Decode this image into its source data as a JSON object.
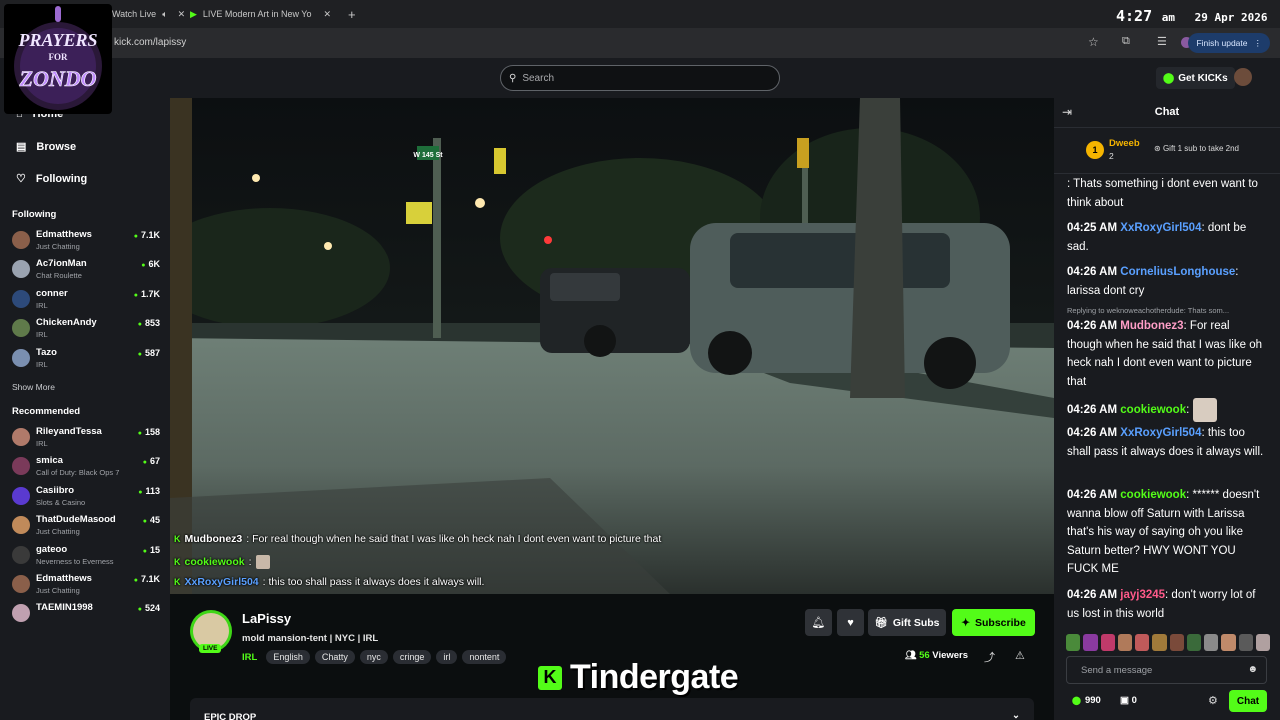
{
  "browser": {
    "tabs": [
      {
        "label": "Watch Live"
      },
      {
        "label": "LIVE Modern Art in New Yo"
      }
    ],
    "url": "kick.com/lapissy",
    "finish_update": "Finish update"
  },
  "clock": {
    "time": "4:27",
    "ampm": "am",
    "date": "29 Apr 2026"
  },
  "logo": {
    "line1": "PRAYERS",
    "line2": "FOR",
    "line3": "ZONDO"
  },
  "header": {
    "search_placeholder": "Search",
    "get_kicks": "Get KICKs"
  },
  "sidebar": {
    "nav": [
      {
        "label": "Home"
      },
      {
        "label": "Browse"
      },
      {
        "label": "Following"
      }
    ],
    "following_heading": "Following",
    "following": [
      {
        "name": "Edmatthews",
        "category": "Just Chatting",
        "viewers": "7.1K",
        "color": "#8a5f4a"
      },
      {
        "name": "Ac7ionMan",
        "category": "Chat Roulette",
        "viewers": "6K",
        "color": "#9aa3b0"
      },
      {
        "name": "conner",
        "category": "IRL",
        "viewers": "1.7K",
        "color": "#2d4a7a"
      },
      {
        "name": "ChickenAndy",
        "category": "IRL",
        "viewers": "853",
        "color": "#5f7a4a"
      },
      {
        "name": "Tazo",
        "category": "IRL",
        "viewers": "587",
        "color": "#7a8fb0"
      }
    ],
    "show_more": "Show More",
    "recommended_heading": "Recommended",
    "recommended": [
      {
        "name": "RileyandTessa",
        "category": "IRL",
        "viewers": "158",
        "color": "#b07a6a"
      },
      {
        "name": "smica",
        "category": "Call of Duty: Black Ops 7",
        "viewers": "67",
        "color": "#7a3a5a"
      },
      {
        "name": "Casiibro",
        "category": "Slots & Casino",
        "viewers": "113",
        "color": "#5a3ad0"
      },
      {
        "name": "ThatDudeMasood",
        "category": "Just Chatting",
        "viewers": "45",
        "color": "#c08a5a"
      },
      {
        "name": "gateoo",
        "category": "Neverness to Everness",
        "viewers": "15",
        "color": "#3a3a3a"
      },
      {
        "name": "Edmatthews",
        "category": "Just Chatting",
        "viewers": "7.1K",
        "color": "#8a5f4a"
      },
      {
        "name": "TAEMIN1998",
        "category": "",
        "viewers": "524",
        "color": "#c0a0b0"
      }
    ]
  },
  "video": {
    "street_sign": "W 145 St",
    "overlay_chat": [
      {
        "user": "Mudbonez3",
        "text": ": For real though when he said that I was like oh heck nah I dont even want to picture that",
        "color": "#ffffff"
      },
      {
        "user": "cookiewook",
        "text": ":",
        "color": "#53fc18"
      },
      {
        "user": "XxRoxyGirl504",
        "text": ": this too shall pass it always does it always will.",
        "color": "#5aa0ff"
      }
    ]
  },
  "stream": {
    "name": "LaPissy",
    "live": "LIVE",
    "title": "mold mansion-tent | NYC | IRL",
    "category": "IRL",
    "tags": [
      "English",
      "Chatty",
      "nyc",
      "cringe",
      "irl",
      "nontent"
    ],
    "gift_subs": "Gift Subs",
    "subscribe": "Subscribe",
    "viewer_count": "56",
    "viewers_label": "Viewers",
    "overlay_word": "Tindergate",
    "epic_drop": "EPIC DROP"
  },
  "chat": {
    "title": "Chat",
    "pinned": {
      "rank": "1",
      "name": "Dweeb",
      "count": "2",
      "gift_text": "Gift 1 sub to take 2nd"
    },
    "messages": [
      {
        "time": "",
        "user": "",
        "text": ": Thats something i dont even want to think about",
        "color": "#ffffff"
      },
      {
        "time": "04:25 AM",
        "user": "XxRoxyGirl504",
        "text": ": dont be sad.",
        "color": "#5aa0ff"
      },
      {
        "time": "04:26 AM",
        "user": "CorneliusLonghouse",
        "text": ": larissa dont cry",
        "color": "#5aa0ff"
      },
      {
        "time": "04:26 AM",
        "user": "Mudbonez3",
        "text": ": For real though when he said that I was like oh heck nah I dont even want to picture that",
        "color": "#ff9ec7"
      },
      {
        "time": "04:26 AM",
        "user": "cookiewook",
        "text": ":",
        "color": "#53fc18"
      },
      {
        "time": "04:26 AM",
        "user": "XxRoxyGirl504",
        "text": ": this too shall pass it always does it always will.",
        "color": "#5aa0ff"
      },
      {
        "time": "04:26 AM",
        "user": "cookiewook",
        "text": ": ****** doesn't wanna blow off Saturn with Larissa that's his way of saying oh you like Saturn better? HWY WONT YOU FUCK ME",
        "color": "#53fc18"
      },
      {
        "time": "04:26 AM",
        "user": "jayj3245",
        "text": ": don't worry lot of us lost in this world",
        "color": "#ff5a8a"
      }
    ],
    "reply_note": "Replying to weknoweachotherdude: Thats som...",
    "send_placeholder": "Send a message",
    "kicks_balance": "990",
    "bits_count": "0",
    "chat_button": "Chat"
  },
  "colors": {
    "accent": "#53fc18",
    "bg": "#0b0e0f",
    "panel": "#191b1f"
  }
}
